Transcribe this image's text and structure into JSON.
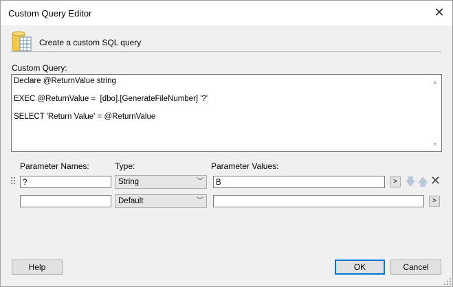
{
  "window": {
    "title": "Custom Query Editor"
  },
  "header": {
    "icon": "database-icon",
    "text": "Create a custom SQL query"
  },
  "query": {
    "label": "Custom Query:",
    "lines": [
      "Declare @ReturnValue string",
      "EXEC @ReturnValue =  [dbo].[GenerateFileNumber] '?'",
      "SELECT 'Return Value' = @ReturnValue"
    ]
  },
  "params": {
    "names_label": "Parameter Names:",
    "type_label": "Type:",
    "values_label": "Parameter Values:",
    "rows": [
      {
        "name": "?",
        "type": "String",
        "value": "B"
      },
      {
        "name": "",
        "type": "Default",
        "value": ""
      }
    ],
    "browse_label": ">"
  },
  "buttons": {
    "help": "Help",
    "ok": "OK",
    "cancel": "Cancel"
  },
  "colors": {
    "accent": "#0078d7",
    "window_bg": "#f0f0f0"
  }
}
